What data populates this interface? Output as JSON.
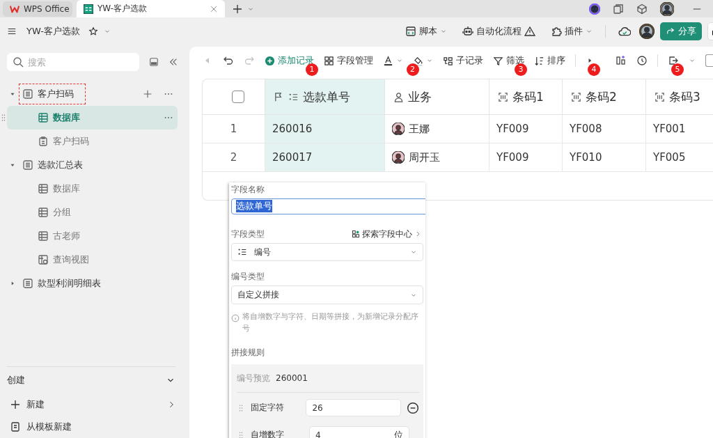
{
  "browser_tabs": [
    {
      "label": "WPS Office",
      "kind": "home",
      "selected": false
    },
    {
      "label": "YW-客户选款",
      "kind": "document",
      "selected": true
    }
  ],
  "document": {
    "title": "YW-客户选款"
  },
  "header_actions": [
    {
      "label": "脚本",
      "kind": "script"
    },
    {
      "label": "自动化流程",
      "kind": "automation"
    },
    {
      "label": "插件",
      "kind": "plugin"
    }
  ],
  "share_button": {
    "label": "分享"
  },
  "sidebar": {
    "search": {
      "placeholder": "搜索"
    },
    "tree": [
      {
        "label": "客户扫码",
        "kind": "table",
        "expanded": true,
        "selected": false,
        "highlighted": true,
        "hovered": true,
        "children": [
          {
            "label": "数据库",
            "kind": "grid",
            "selected": true,
            "highlighted": false,
            "hovered": false
          },
          {
            "label": "客户扫码",
            "kind": "form",
            "selected": false,
            "highlighted": false,
            "hovered": false
          }
        ]
      },
      {
        "label": "选款汇总表",
        "kind": "table",
        "expanded": true,
        "selected": false,
        "highlighted": false,
        "hovered": false,
        "children": [
          {
            "label": "数据库",
            "kind": "grid",
            "selected": false,
            "highlighted": false,
            "hovered": false
          },
          {
            "label": "分组",
            "kind": "grid",
            "selected": false,
            "highlighted": false,
            "hovered": false
          },
          {
            "label": "古老师",
            "kind": "grid",
            "selected": false,
            "highlighted": false,
            "hovered": false
          },
          {
            "label": "查询视图",
            "kind": "query",
            "selected": false,
            "highlighted": false,
            "hovered": false
          }
        ]
      },
      {
        "label": "款型利润明细表",
        "kind": "table",
        "expanded": false,
        "selected": false,
        "highlighted": false,
        "hovered": false
      }
    ],
    "create": {
      "title": "创建",
      "items": [
        {
          "label": "新建",
          "kind": "new"
        },
        {
          "label": "从模板新建",
          "kind": "template"
        }
      ]
    }
  },
  "toolbar": {
    "nav": [
      {
        "kind": "back",
        "disabled": true
      },
      {
        "kind": "undo",
        "disabled": false
      },
      {
        "kind": "redo",
        "disabled": true
      }
    ],
    "items": [
      {
        "kind": "add",
        "label": "添加记录"
      },
      {
        "kind": "fields",
        "label": "字段管理"
      },
      {
        "kind": "font-color"
      },
      {
        "kind": "fill-color"
      },
      {
        "kind": "subrecord",
        "label": "子记录"
      },
      {
        "kind": "filter",
        "label": "筛选"
      },
      {
        "kind": "sort",
        "label": "排序"
      }
    ]
  },
  "table": {
    "select_all": {
      "checked": false
    },
    "columns": [
      {
        "label": "选款单号",
        "kind": "autonumber",
        "primary": true,
        "badge": "1"
      },
      {
        "label": "业务",
        "kind": "person",
        "primary": false,
        "badge": "2"
      },
      {
        "label": "条码1",
        "kind": "barcode",
        "primary": false,
        "badge": "3"
      },
      {
        "label": "条码2",
        "kind": "barcode",
        "primary": false,
        "badge": "4"
      },
      {
        "label": "条码3",
        "kind": "barcode",
        "primary": false,
        "badge": "5"
      }
    ],
    "rows": [
      {
        "number": "1",
        "cells": [
          "260016",
          "王娜",
          "YF009",
          "YF008",
          "YF001"
        ]
      },
      {
        "number": "2",
        "cells": [
          "260017",
          "周开玉",
          "YF009",
          "YF010",
          "YF005"
        ]
      }
    ]
  },
  "field_editor": {
    "name_label": "字段名称",
    "name_value": "选款单号",
    "type_label": "字段类型",
    "type_link": "探索字段中心",
    "type_value": "编号",
    "number_type_label": "编号类型",
    "number_type_value": "自定义拼接",
    "hint": "将自增数字与字符、日期等拼接，为新增记录分配序号",
    "rule_label": "拼接规则",
    "preview_label": "编号预览",
    "preview_value": "260001",
    "parts": [
      {
        "kind": "fixed",
        "label": "固定字符",
        "value": "26"
      },
      {
        "kind": "counter",
        "label": "自增数字",
        "value": "4",
        "unit": "位"
      }
    ]
  }
}
